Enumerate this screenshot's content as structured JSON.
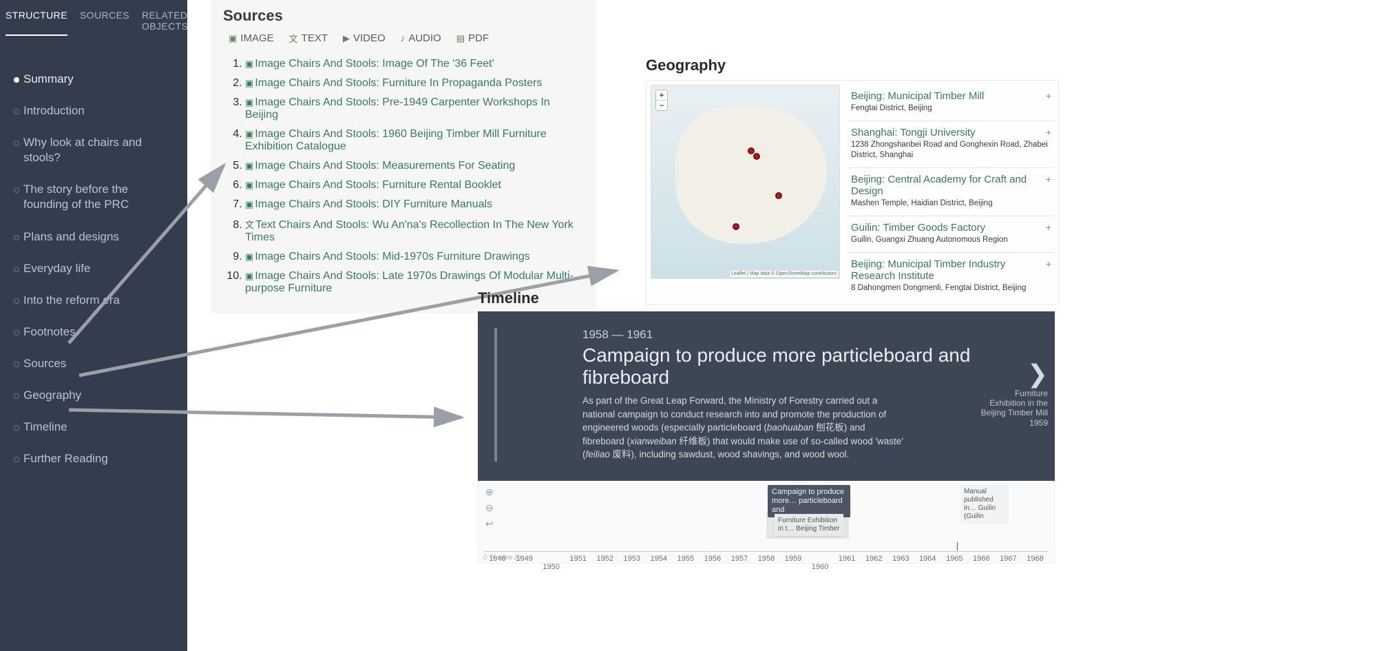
{
  "sidebar": {
    "tabs": [
      "STRUCTURE",
      "SOURCES",
      "RELATED OBJECTS"
    ],
    "active_tab": 0,
    "items": [
      "Summary",
      "Introduction",
      "Why look at chairs and stools?",
      "The story before the founding of the PRC",
      "Plans and designs",
      "Everyday life",
      "Into the reform era",
      "Footnotes",
      "Sources",
      "Geography",
      "Timeline",
      "Further Reading"
    ],
    "active_item": 0
  },
  "sources": {
    "title": "Sources",
    "filters": [
      {
        "icon": "image-icon",
        "label": "IMAGE"
      },
      {
        "icon": "text-icon",
        "label": "TEXT"
      },
      {
        "icon": "video-icon",
        "label": "VIDEO"
      },
      {
        "icon": "audio-icon",
        "label": "AUDIO"
      },
      {
        "icon": "pdf-icon",
        "label": "PDF"
      }
    ],
    "items": [
      {
        "type": "Image",
        "title": "Chairs And Stools: Image Of The '36 Feet'"
      },
      {
        "type": "Image",
        "title": "Chairs And Stools: Furniture In Propaganda Posters"
      },
      {
        "type": "Image",
        "title": "Chairs And Stools: Pre-1949 Carpenter Workshops In Beijing"
      },
      {
        "type": "Image",
        "title": "Chairs And Stools: 1960 Beijing Timber Mill Furniture Exhibition Catalogue"
      },
      {
        "type": "Image",
        "title": "Chairs And Stools: Measurements For Seating"
      },
      {
        "type": "Image",
        "title": "Chairs And Stools: Furniture Rental Booklet"
      },
      {
        "type": "Image",
        "title": "Chairs And Stools: DIY Furniture Manuals"
      },
      {
        "type": "Text",
        "title": "Chairs And Stools: Wu An'na's Recollection In The New York Times"
      },
      {
        "type": "Image",
        "title": "Chairs And Stools: Mid-1970s Furniture Drawings"
      },
      {
        "type": "Image",
        "title": "Chairs And Stools: Late 1970s Drawings Of Modular Multi-purpose Furniture"
      }
    ]
  },
  "geography": {
    "title": "Geography",
    "zoom_in": "+",
    "zoom_out": "−",
    "attribution": "Leaflet | Map data © OpenStreetMap contributors",
    "items": [
      {
        "title": "Beijing: Municipal Timber Mill",
        "sub": "Fengtai District, Beijing"
      },
      {
        "title": "Shanghai: Tongji University",
        "sub": "1238 Zhongshanbei Road and Gonghexin Road, Zhabei District, Shanghai"
      },
      {
        "title": "Beijing: Central Academy for Craft and Design",
        "sub": "Mashen Temple, Haidian District, Beijing"
      },
      {
        "title": "Guilin: Timber Goods Factory",
        "sub": "Guilin, Guangxi Zhuang Autonomous Region"
      },
      {
        "title": "Beijing: Municipal Timber Industry Research Institute",
        "sub": "8 Dahongmen Dongmenli, Fengtai District, Beijing"
      }
    ]
  },
  "timeline": {
    "title": "Timeline",
    "dates": "1958 — 1961",
    "headline": "Campaign to produce more particleboard and fibreboard",
    "body_pre": "As part of the Great Leap Forward, the Ministry of Forestry carried out a national campaign to conduct research into and promote the production of engineered woods (especially particleboard (",
    "body_i1": "baohuaban",
    "body_mid1": " 刨花板) and fibreboard (",
    "body_i2": "xianweiban",
    "body_mid2": " 纤维板) that would make use of so-called wood 'waste' (",
    "body_i3": "feiliao",
    "body_post": " 废料), including sawdust, wood shavings, and wood wool.",
    "next_label": "Furniture Exhibition in the Beijing Timber Mill",
    "next_year": "1959",
    "track_event_main": "Campaign to produce more… particleboard and",
    "track_event_sub": "Furniture Exhibition in t… Beijing Timber",
    "track_event_right": "Manual published in… Guilin (Guilin",
    "years_top": [
      "1948",
      "1949",
      "",
      "1951",
      "1952",
      "1953",
      "1954",
      "1955",
      "1956",
      "1957",
      "1958",
      "1959",
      "",
      "1961",
      "1962",
      "1963",
      "1964",
      "1965",
      "1966",
      "1967",
      "1968"
    ],
    "years_bottom": [
      "",
      "",
      "1950",
      "",
      "",
      "",
      "",
      "",
      "",
      "",
      "",
      "",
      "1960",
      "",
      "",
      "",
      "",
      "",
      "",
      "",
      ""
    ],
    "tjs": "⏱ Timeline JS"
  }
}
